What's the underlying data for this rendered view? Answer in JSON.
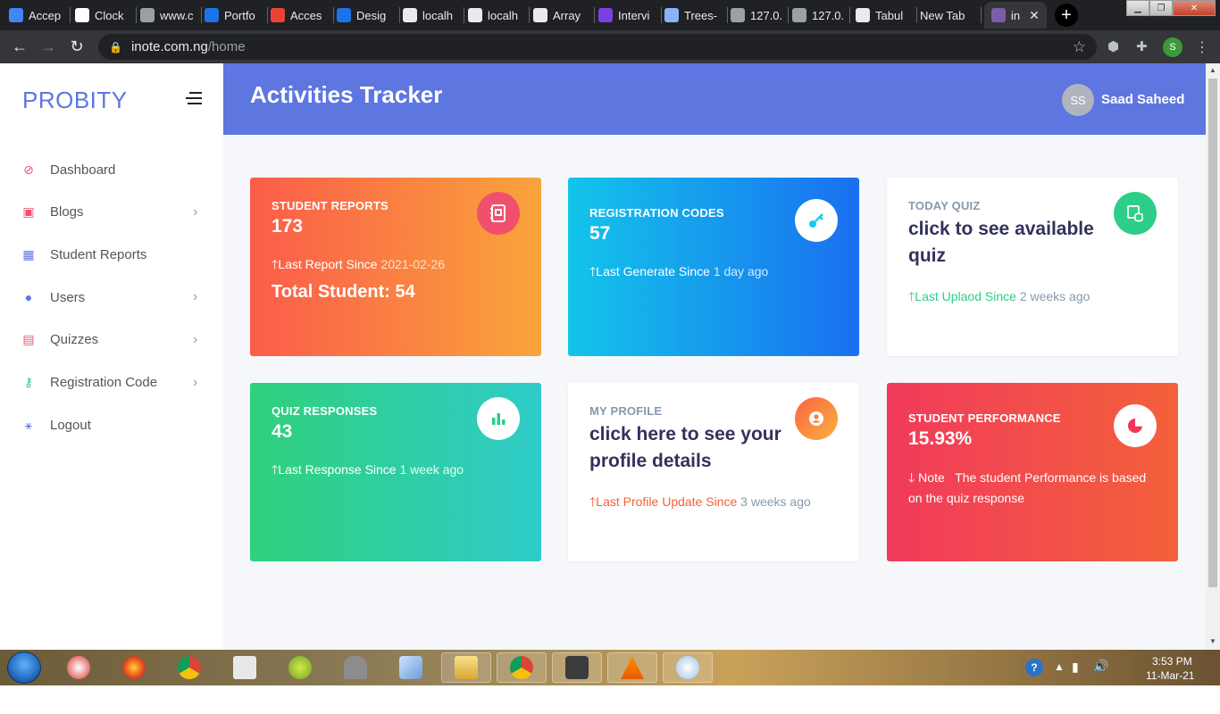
{
  "browser": {
    "tabs": [
      {
        "title": "Accep",
        "fav_color": "#4285f4"
      },
      {
        "title": "Clock",
        "fav_color": "#ffffff"
      },
      {
        "title": "www.c",
        "fav_color": "#9aa0a6"
      },
      {
        "title": "Portfo",
        "fav_color": "#1a73e8"
      },
      {
        "title": "Acces",
        "fav_color": "#ea4335"
      },
      {
        "title": "Desig",
        "fav_color": "#1a73e8"
      },
      {
        "title": "localh",
        "fav_color": "#e8eaed"
      },
      {
        "title": "localh",
        "fav_color": "#e8eaed"
      },
      {
        "title": "Array",
        "fav_color": "#e8eaed"
      },
      {
        "title": "Intervi",
        "fav_color": "#7b3fe4"
      },
      {
        "title": "Trees-",
        "fav_color": "#8ab4f8"
      },
      {
        "title": "127.0.",
        "fav_color": "#9aa0a6"
      },
      {
        "title": "127.0.",
        "fav_color": "#9aa0a6"
      },
      {
        "title": "Tabul",
        "fav_color": "#e8eaed"
      },
      {
        "title": "New Tab",
        "fav_color": ""
      },
      {
        "title": "in",
        "fav_color": "#7b5ea7"
      }
    ],
    "url_host": "inote.com.ng",
    "url_path": "/home",
    "profile_initial": "S"
  },
  "sidebar": {
    "brand": "PROBITY",
    "items": [
      {
        "label": "Dashboard",
        "icon": "compass-icon",
        "color": "#f0506e",
        "has_submenu": false
      },
      {
        "label": "Blogs",
        "icon": "notebook-icon",
        "color": "#f0506e",
        "has_submenu": true
      },
      {
        "label": "Student Reports",
        "icon": "id-badge-icon",
        "color": "#5d76e0",
        "has_submenu": false
      },
      {
        "label": "Users",
        "icon": "user-icon",
        "color": "#5d76e0",
        "has_submenu": true
      },
      {
        "label": "Quizzes",
        "icon": "document-icon",
        "color": "#f0506e",
        "has_submenu": true
      },
      {
        "label": "Registration Code",
        "icon": "key-icon",
        "color": "#2dce89",
        "has_submenu": true
      },
      {
        "label": "Logout",
        "icon": "running-icon",
        "color": "#5d76e0",
        "has_submenu": false
      }
    ]
  },
  "header": {
    "title": "Activities Tracker",
    "user_initials": "SS",
    "user_name": "Saad Saheed"
  },
  "cards": {
    "student_reports": {
      "title": "STUDENT REPORTS",
      "value": "173",
      "line_prefix": "Last Report Since",
      "line_value": "2021-02-26",
      "extra": "Total Student: 54"
    },
    "registration_codes": {
      "title": "REGISTRATION CODES",
      "value": "57",
      "line_prefix": "Last Generate Since",
      "line_value": "1 day ago"
    },
    "today_quiz": {
      "title": "TODAY QUIZ",
      "value": "click to see available quiz",
      "line_prefix": "Last Uplaod Since",
      "line_value": "2 weeks ago"
    },
    "quiz_responses": {
      "title": "QUIZ RESPONSES",
      "value": "43",
      "line_prefix": "Last Response Since",
      "line_value": "1 week ago"
    },
    "my_profile": {
      "title": "MY PROFILE",
      "value": "click here to see your profile details",
      "line_prefix": "Last Profile Update Since",
      "line_value": "3 weeks ago"
    },
    "student_performance": {
      "title": "STUDENT PERFORMANCE",
      "value": "15.93%",
      "note_label": "Note",
      "note_text": "The student Performance is based on the quiz response"
    }
  },
  "colors": {
    "accent": "#5d76e0",
    "orange_start": "#fb5c4a",
    "orange_end": "#f9a43b",
    "blue_start": "#12c5ea",
    "blue_end": "#1a6ff0",
    "green_start": "#2fd17a",
    "green_end": "#2fcbc9",
    "red_start": "#f13a5b",
    "red_end": "#f3613a",
    "teal_icon": "#2dce89",
    "orange_text": "#f5603a",
    "green_text": "#2dce89"
  },
  "taskbar": {
    "time": "3:53 PM",
    "date": "11-Mar-21"
  }
}
